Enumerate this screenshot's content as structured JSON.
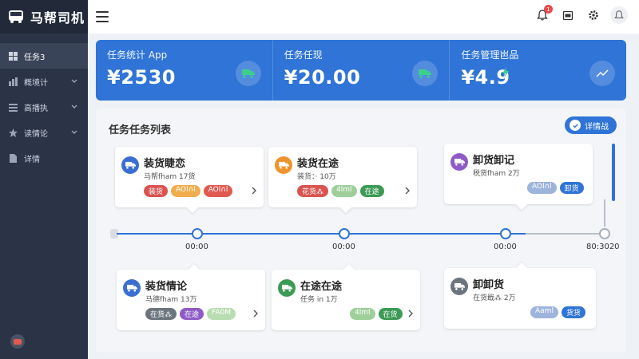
{
  "app": {
    "title": "马帮司机"
  },
  "sidebar": {
    "items": [
      {
        "label": "任务3",
        "icon": "dashboard-icon",
        "active": true,
        "has_chevron": false
      },
      {
        "label": "概境计",
        "icon": "chart-icon",
        "active": false,
        "has_chevron": true
      },
      {
        "label": "高播执",
        "icon": "list-icon",
        "active": false,
        "has_chevron": true
      },
      {
        "label": "读情论",
        "icon": "star-icon",
        "active": false,
        "has_chevron": true
      },
      {
        "label": "详情",
        "icon": "document-icon",
        "active": false,
        "has_chevron": false
      }
    ]
  },
  "header": {
    "notification_count": "1"
  },
  "stats": [
    {
      "label": "任务统计 App",
      "value": "¥2530",
      "icon": "truck-icon"
    },
    {
      "label": "任务任现",
      "value": "¥20.00",
      "icon": "truck-icon"
    },
    {
      "label": "任务管理岜品",
      "value": "¥4.9",
      "icon": "trend-icon"
    }
  ],
  "panel": {
    "title": "任务任务列表",
    "detail_button": "详情战"
  },
  "timeline": {
    "labels": [
      "00:00",
      "00:00",
      "00:00",
      "80:3020"
    ]
  },
  "cards": {
    "top": [
      {
        "title": "装货睫恋",
        "sub": "马帮fham 17货",
        "icon": "truck-icon",
        "icon_color": "#3a6fd1",
        "tags": [
          {
            "text": "装货",
            "color": "#d9534f"
          },
          {
            "text": "AOl∩l",
            "color": "#f0ad4e"
          },
          {
            "text": "AOl∩l",
            "color": "#e05a50"
          }
        ]
      },
      {
        "title": "装货在途",
        "sub": "装货：· 10万",
        "icon": "truck-icon",
        "icon_color": "#f0932b",
        "tags": [
          {
            "text": "花货⁂",
            "color": "#d9534f"
          },
          {
            "text": "4lml",
            "color": "#9fcf9a"
          },
          {
            "text": "在途",
            "color": "#3c9a55"
          }
        ]
      },
      {
        "title": "卸货卸记",
        "sub": "税货fham 2万",
        "icon": "truck-icon",
        "icon_color": "#8e5bc6",
        "tags": [
          {
            "text": "AOl∩l",
            "color": "#9db4dd"
          },
          {
            "text": "卸货",
            "color": "#2f74d6"
          }
        ]
      }
    ],
    "bottom": [
      {
        "title": "装货情论",
        "sub": "马德fham 13万",
        "icon": "truck-icon",
        "icon_color": "#3a6fd1",
        "tags": [
          {
            "text": "在货⁂",
            "color": "#6c757d"
          },
          {
            "text": "在途",
            "color": "#8e5bc6"
          },
          {
            "text": "FA0M",
            "color": "#b8ddb0"
          }
        ]
      },
      {
        "title": "在途在途",
        "sub": "任务 in  1万",
        "icon": "truck-icon",
        "icon_color": "#3c9a55",
        "tags": [
          {
            "text": "4lml",
            "color": "#9fcf9a"
          },
          {
            "text": "在货",
            "color": "#3c9a55"
          }
        ]
      },
      {
        "title": "卸卸货",
        "sub": "在货戢⁂  2万",
        "icon": "truck-icon",
        "icon_color": "#6c757d",
        "tags": [
          {
            "text": "Aaml",
            "color": "#9db4dd"
          },
          {
            "text": "货货",
            "color": "#2f74d6"
          }
        ]
      }
    ]
  },
  "colors": {
    "primary": "#2f74d6",
    "sidebar": "#2b3447",
    "brand_bar": "#222a3a"
  }
}
